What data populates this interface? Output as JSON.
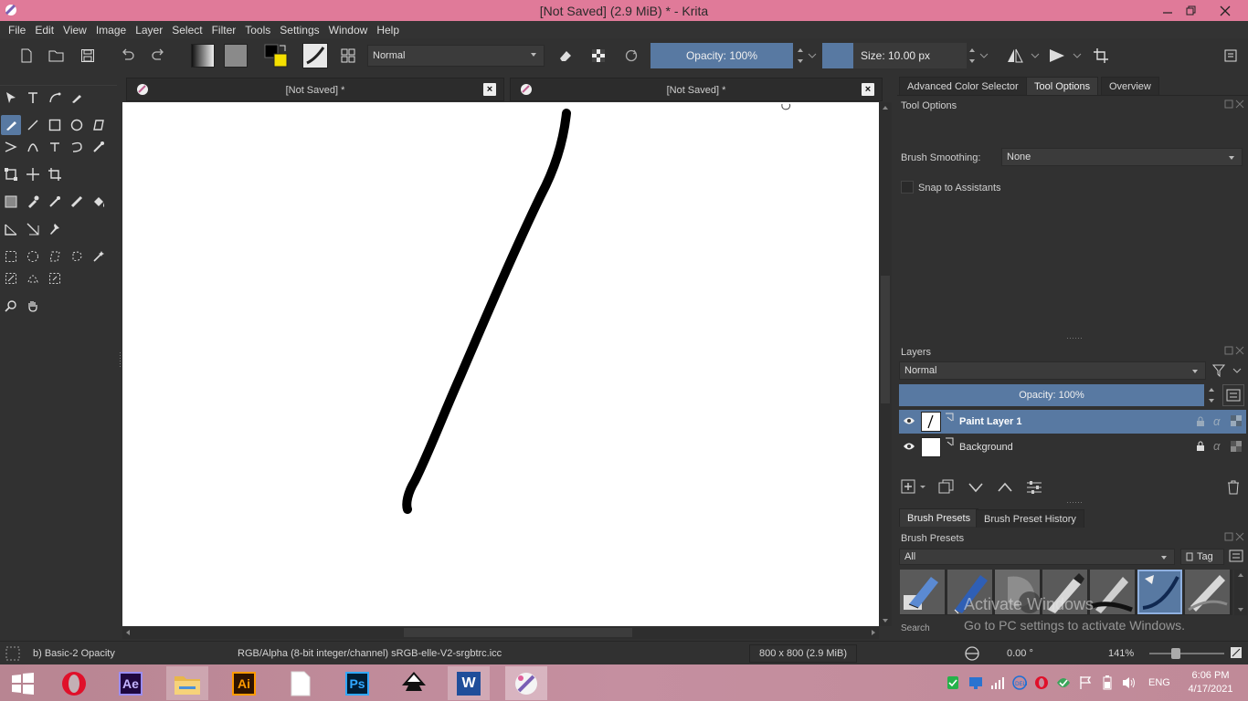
{
  "window": {
    "title": "[Not Saved]  (2.9 MiB)  * - Krita"
  },
  "menu": [
    "File",
    "Edit",
    "View",
    "Image",
    "Layer",
    "Select",
    "Filter",
    "Tools",
    "Settings",
    "Window",
    "Help"
  ],
  "toolbar": {
    "blend_mode": "Normal",
    "opacity_label": "Opacity: 100%",
    "size_label": "Size: 10.00 px"
  },
  "tabs": [
    {
      "label": "[Not Saved]  *",
      "close": "×"
    },
    {
      "label": "[Not Saved]  *",
      "close": "×"
    }
  ],
  "docker": {
    "tabs": [
      "Advanced Color Selector",
      "Tool Options",
      "Overview"
    ],
    "selected_tab": "Tool Options",
    "tool_options": {
      "title": "Tool Options",
      "smoothing_label": "Brush Smoothing:",
      "smoothing_value": "None",
      "snap_label": "Snap to Assistants"
    },
    "layers": {
      "title": "Layers",
      "blend_mode": "Normal",
      "opacity_label": "Opacity:  100%",
      "items": [
        {
          "name": "Paint Layer 1",
          "selected": true
        },
        {
          "name": "Background",
          "selected": false
        }
      ]
    },
    "brush": {
      "tabs": [
        "Brush Presets",
        "Brush Preset History"
      ],
      "title": "Brush Presets",
      "filter": "All",
      "tag_label": "Tag",
      "search_label": "Search"
    }
  },
  "status": {
    "brush_name": "b) Basic-2 Opacity",
    "color_space": "RGB/Alpha (8-bit integer/channel)  sRGB-elle-V2-srgbtrc.icc",
    "image_size": "800 x 800 (2.9 MiB)",
    "rotation": "0.00 °",
    "zoom": "141%"
  },
  "watermark": {
    "line1": "Activate Windows",
    "line2": "Go to PC settings to activate Windows."
  },
  "taskbar": {
    "apps": [
      "Windows Start",
      "Opera",
      "After Effects",
      "File Explorer",
      "Illustrator",
      "Document",
      "Photoshop",
      "Inkscape",
      "Word",
      "Krita"
    ],
    "ae_label": "Ae",
    "ai_label": "Ai",
    "ps_label": "Ps",
    "w_label": "W",
    "lang": "ENG",
    "time": "6:06 PM",
    "date": "4/17/2021"
  },
  "colors": {
    "title_bar": "#e07a99",
    "accent": "#5879a2",
    "panel": "#313131",
    "canvas": "#ffffff",
    "foreground": "#000000",
    "background_color": "#f5e000"
  }
}
